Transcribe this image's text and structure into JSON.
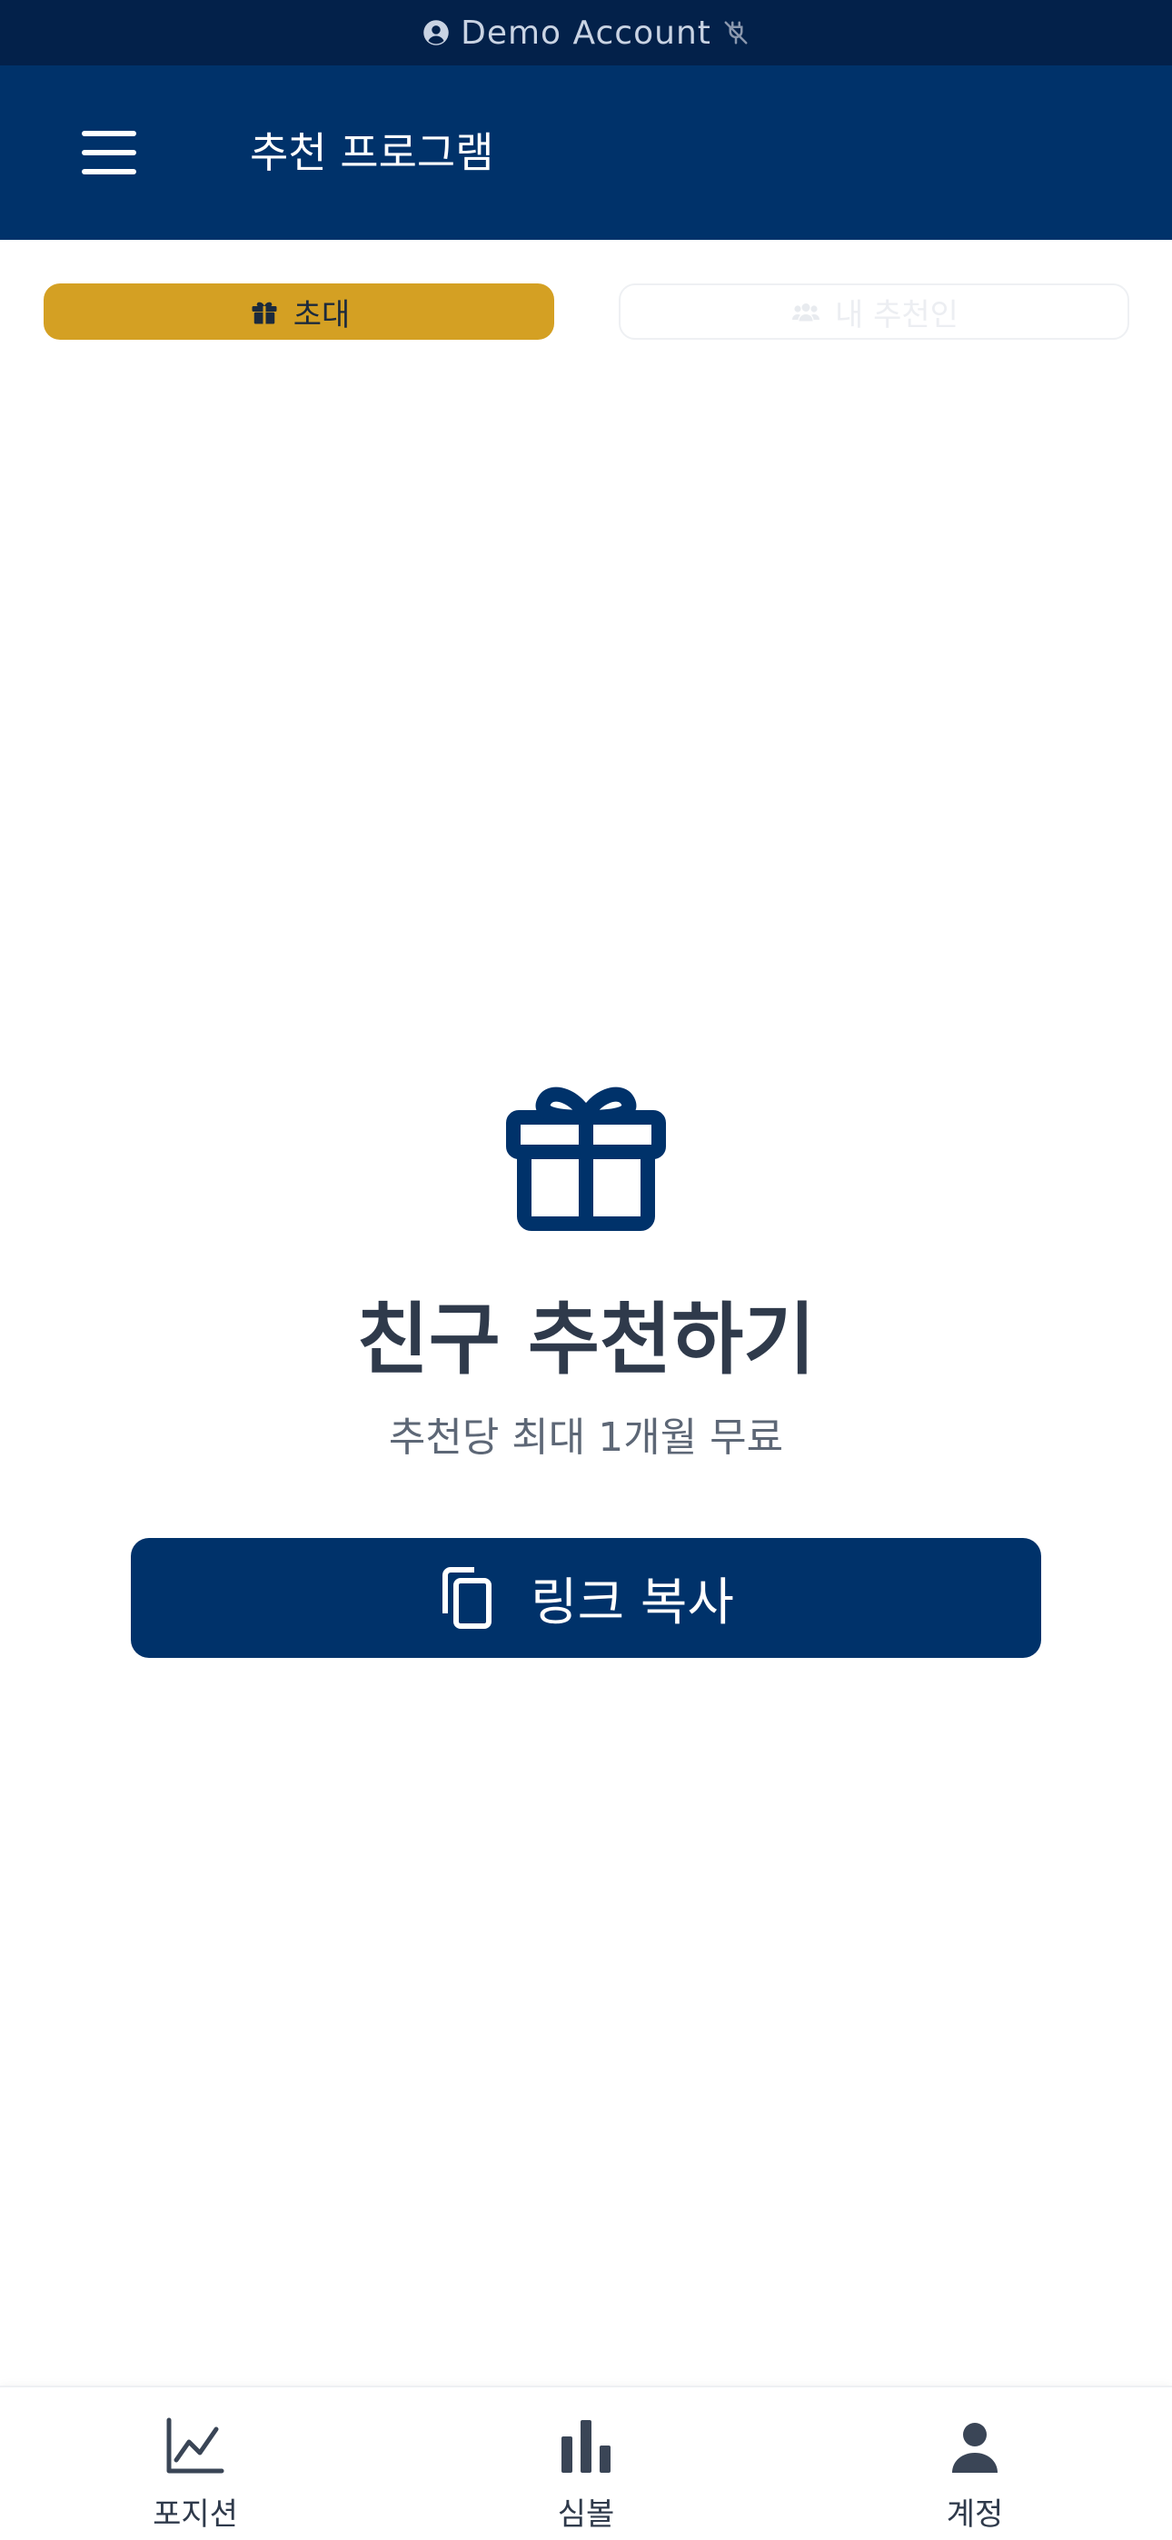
{
  "demo_bar": {
    "label": "Demo Account",
    "icons": [
      "user-circle-icon",
      "plug-off-icon"
    ]
  },
  "header": {
    "title": "추천 프로그램",
    "menu_icon": "hamburger-menu-icon"
  },
  "tabs": [
    {
      "label": "초대",
      "icon": "gift-icon",
      "active": true
    },
    {
      "label": "내 추천인",
      "icon": "users-icon",
      "active": false
    }
  ],
  "main": {
    "icon": "gift-icon",
    "title": "친구 추천하기",
    "subtitle": "추천당 최대 1개월 무료",
    "copy_button": {
      "label": "링크 복사",
      "icon": "copy-icon"
    }
  },
  "bottom_nav": [
    {
      "label": "포지션",
      "icon": "chart-line-icon"
    },
    {
      "label": "심볼",
      "icon": "bar-chart-icon"
    },
    {
      "label": "계정",
      "icon": "user-icon"
    }
  ],
  "colors": {
    "navy": "#00326a",
    "demo_bar": "#03214a",
    "gold": "#d4a023",
    "text_dark": "#2f3a4b",
    "text_muted": "#5d6776"
  }
}
